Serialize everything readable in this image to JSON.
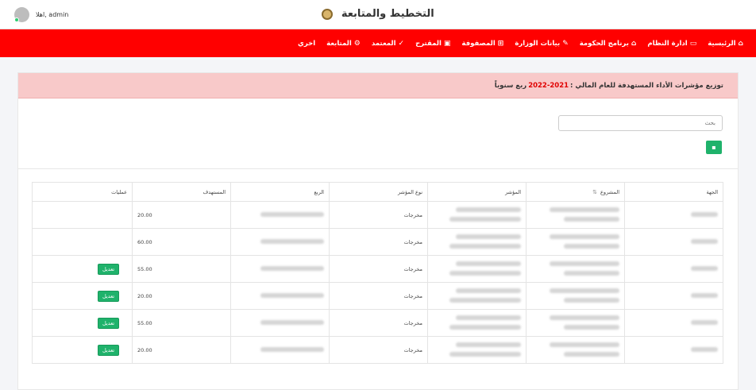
{
  "header": {
    "app_title": "التخطيط والمتابعة",
    "user_greeting": "اهلا, admin"
  },
  "nav": {
    "items": [
      {
        "label": "الرئيسية",
        "icon": "home-icon"
      },
      {
        "label": "ادارة النظام",
        "icon": "monitor-icon"
      },
      {
        "label": "برنامج الحكومة",
        "icon": "bank-icon"
      },
      {
        "label": "بيانات الوزارة",
        "icon": "edit-icon"
      },
      {
        "label": "المصفوفة",
        "icon": "grid-icon"
      },
      {
        "label": "المقترح",
        "icon": "card-icon"
      },
      {
        "label": "المعتمد",
        "icon": "check-icon"
      },
      {
        "label": "المتابعة",
        "icon": "gears-icon"
      },
      {
        "label": "اخري",
        "icon": ""
      }
    ]
  },
  "alert": {
    "prefix": "توزيع مؤشرات الأداء المستهدفة للعام المالي :",
    "year": "2022-2021",
    "suffix": "ربع سنوياً"
  },
  "search": {
    "placeholder": "بحث"
  },
  "table": {
    "headers": [
      "الجهة",
      "المشروع",
      "المؤشر",
      "نوع المؤشر",
      "الربع",
      "المستهدف",
      "عمليات"
    ],
    "edit_label": "تعديل",
    "rows": [
      {
        "type": "مخرجات",
        "target": "20.00",
        "editable": false
      },
      {
        "type": "مخرجات",
        "target": "60.00",
        "editable": false
      },
      {
        "type": "مخرجات",
        "target": "55.00",
        "editable": true
      },
      {
        "type": "مخرجات",
        "target": "20.00",
        "editable": true
      },
      {
        "type": "مخرجات",
        "target": "55.00",
        "editable": true
      },
      {
        "type": "مخرجات",
        "target": "20.00",
        "editable": true
      }
    ]
  },
  "colors": {
    "nav_bg": "#ff0000",
    "alert_bg": "#f8c9c9",
    "accent_green": "#1fb26b",
    "year_red": "#e00000"
  }
}
